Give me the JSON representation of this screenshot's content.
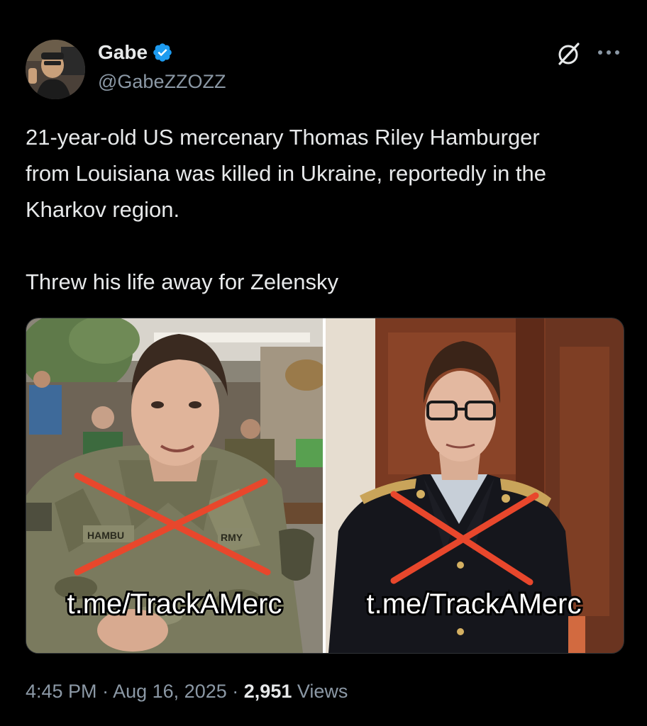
{
  "author": {
    "display_name": "Gabe",
    "handle": "@GabeZZOZZ",
    "verified_color": "#1d9bf0"
  },
  "icons": {
    "verified": "verified-badge-icon",
    "grok": "grok-icon",
    "more": "more-options-icon"
  },
  "tweet": {
    "text_line_1": "21-year-old US mercenary Thomas Riley Hamburger",
    "text_line_2": "from Louisiana was killed in Ukraine, reportedly in the",
    "text_line_3": "Kharkov region.",
    "text_line_4": "Threw his life away for Zelensky"
  },
  "media": {
    "left_caption": "t.me/TrackAMerc",
    "right_caption": "t.me/TrackAMerc",
    "left_patch_text": "HAMBU",
    "left_patch_text_2": "RMY",
    "cross_color": "#e8472c"
  },
  "meta": {
    "time": "4:45 PM",
    "separator": "·",
    "date": "Aug 16, 2025",
    "views_count": "2,951",
    "views_label": "Views"
  }
}
